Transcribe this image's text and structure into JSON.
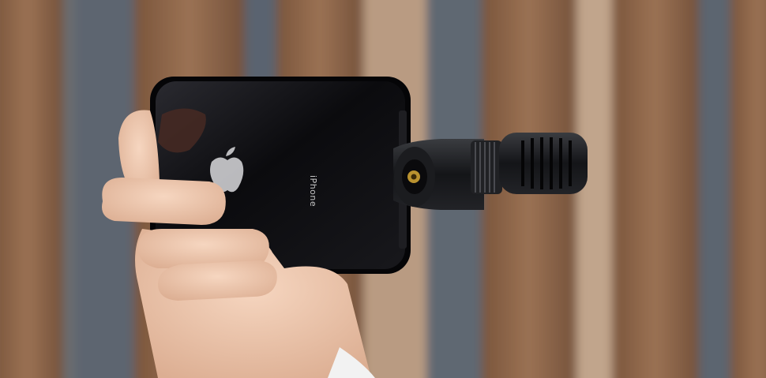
{
  "photo": {
    "phone_brand_text": "iPhone",
    "subjects": [
      "hand",
      "phone",
      "microphone",
      "apple-logo"
    ],
    "colors": {
      "wall_wood": "#8b6447",
      "wall_gap": "#5b6470",
      "phone_body": "#0d0d10",
      "microphone_body": "#1a1b1e",
      "skin": "#f0c9b0"
    }
  }
}
